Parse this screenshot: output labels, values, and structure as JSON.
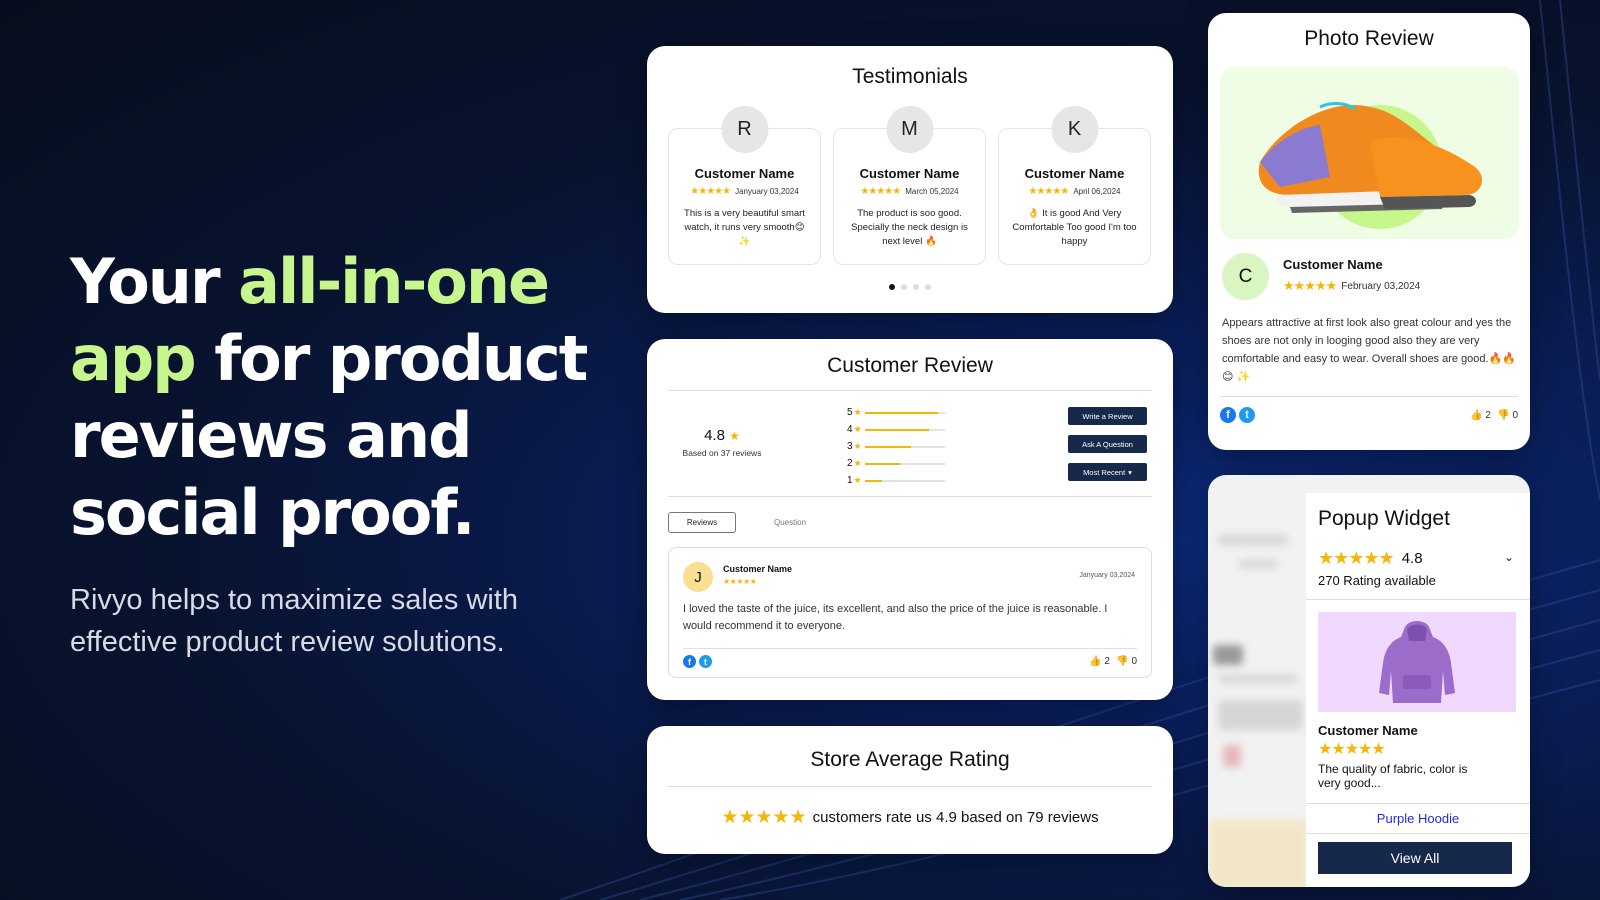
{
  "hero": {
    "title_part1": "Your ",
    "title_accent": "all-in-one app",
    "title_part2": " for product reviews and social proof.",
    "subtitle": "Rivyo helps to maximize sales with effective product review solutions.",
    "accent_color": "#c6f68d"
  },
  "testimonials": {
    "title": "Testimonials",
    "items": [
      {
        "initial": "R",
        "name": "Customer Name",
        "stars": "★★★★★",
        "date": "Janyuary 03,2024",
        "text": "This is a very beautiful smart watch, it runs very smooth😊 ✨"
      },
      {
        "initial": "M",
        "name": "Customer Name",
        "stars": "★★★★★",
        "date": "March 05,2024",
        "text": "The product is soo good. Specially the neck design is next level 🔥"
      },
      {
        "initial": "K",
        "name": "Customer Name",
        "stars": "★★★★★",
        "date": "April 06,2024",
        "text": "👌 It is good And Very Comfortable Too good I'm too happy"
      }
    ],
    "pagination": {
      "total": 4,
      "active": 1
    }
  },
  "customer_review": {
    "title": "Customer Review",
    "average": "4.8",
    "star": "★",
    "based_on": "Based on 37 reviews",
    "distribution": [
      {
        "label": "5",
        "fraction": 0.92
      },
      {
        "label": "4",
        "fraction": 0.81
      },
      {
        "label": "3",
        "fraction": 0.58
      },
      {
        "label": "2",
        "fraction": 0.44
      },
      {
        "label": "1",
        "fraction": 0.22
      }
    ],
    "buttons": {
      "write": "Write a Review",
      "ask": "Ask A Question",
      "sort": "Most Recent",
      "sort_caret": "▾"
    },
    "tabs": {
      "reviews": "Reviews",
      "question": "Question"
    },
    "review": {
      "initial": "J",
      "name": "Customer Name",
      "stars": "★★★★★",
      "date": "Janyuary 03,2024",
      "text": "I loved the taste of the juice, its excellent, and also the price of the juice is reasonable. I would recommend it to everyone.",
      "likes": "2",
      "dislikes": "0"
    }
  },
  "store_rating": {
    "title": "Store Average Rating",
    "stars": "★★★★★",
    "text": "customers rate us 4.9 based on 79 reviews"
  },
  "photo_review": {
    "title": "Photo Review",
    "initial": "C",
    "name": "Customer Name",
    "stars": "★★★★★",
    "date": "February 03,2024",
    "text": "Appears attractive at first look also great colour and yes the shoes are not only in looging good also they are very comfortable and easy to wear. Overall shoes are good.🔥🔥 😊 ✨",
    "likes": "2",
    "dislikes": "0"
  },
  "popup_widget": {
    "title": "Popup Widget",
    "stars": "★★★★★",
    "rating": "4.8",
    "chevron": "⌄",
    "count": "270 Rating available",
    "customer_name": "Customer Name",
    "review_stars": "★★★★★",
    "review_text": "The quality of fabric, color is very good...",
    "product_link": "Purple Hoodie",
    "view_all": "View All"
  },
  "icons": {
    "facebook": "f",
    "twitter": "t",
    "thumbs_up": "👍",
    "thumbs_down": "👎"
  }
}
